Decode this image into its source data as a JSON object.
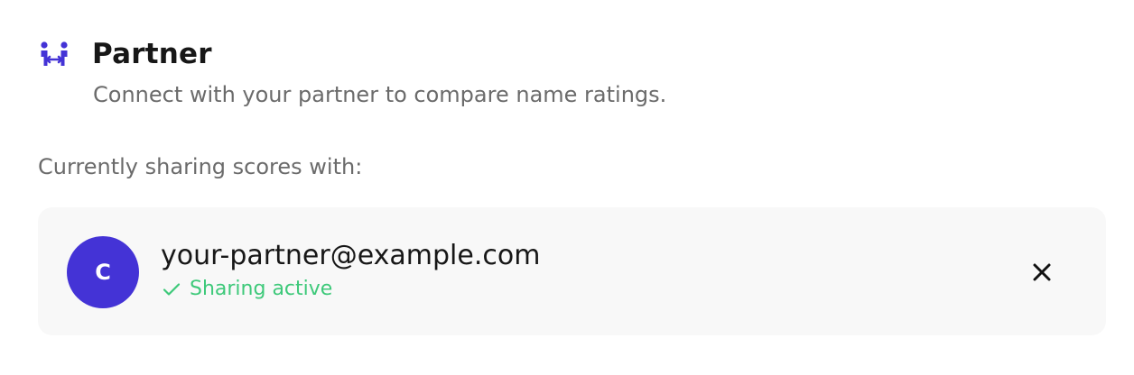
{
  "section": {
    "title": "Partner",
    "description": "Connect with your partner to compare name ratings.",
    "icon": "partner-link-icon",
    "icon_color": "#4433d6"
  },
  "sharing": {
    "label": "Currently sharing scores with:"
  },
  "partner": {
    "avatar_initial": "C",
    "avatar_color": "#4433d6",
    "email": "your-partner@example.com",
    "status": "Sharing active",
    "status_color": "#3ec97a",
    "status_icon": "check-icon",
    "remove_icon": "close-icon"
  }
}
